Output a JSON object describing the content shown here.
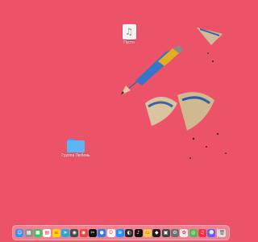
{
  "desktop": {
    "items": [
      {
        "label": "Пусто",
        "icon": "music-file-icon"
      },
      {
        "label": "Группа Любовь",
        "icon": "folder-icon"
      }
    ]
  },
  "dock": {
    "apps": [
      {
        "name": "finder",
        "icon": "finder-icon",
        "color": "#3a8ef0",
        "glyph": "☺"
      },
      {
        "name": "launchpad",
        "icon": "launchpad-icon",
        "color": "#8e8e93",
        "glyph": "▦"
      },
      {
        "name": "facetime",
        "icon": "facetime-icon",
        "color": "#34c759",
        "glyph": "■"
      },
      {
        "name": "calendar",
        "icon": "calendar-icon",
        "color": "#ffffff",
        "glyph": "▤"
      },
      {
        "name": "notes",
        "icon": "notes-icon",
        "color": "#ffd60a",
        "glyph": "≡"
      },
      {
        "name": "telegram",
        "icon": "telegram-icon",
        "color": "#2aa4e0",
        "glyph": "➤"
      },
      {
        "name": "browser",
        "icon": "browser-icon",
        "color": "#4a4a4a",
        "glyph": "◉"
      },
      {
        "name": "chrome",
        "icon": "chrome-icon",
        "color": "#e8453c",
        "glyph": "◉"
      },
      {
        "name": "capcut",
        "icon": "capcut-icon",
        "color": "#111111",
        "glyph": "✂"
      },
      {
        "name": "app-blue",
        "icon": "app-icon",
        "color": "#2c7be5",
        "glyph": "●"
      },
      {
        "name": "opera",
        "icon": "opera-icon",
        "color": "#ffffff",
        "glyph": "O"
      },
      {
        "name": "safari",
        "icon": "safari-icon",
        "color": "#1e90ff",
        "glyph": "⊕"
      },
      {
        "name": "app-dark",
        "icon": "app-icon",
        "color": "#2b2b2b",
        "glyph": "◐"
      },
      {
        "name": "app-black",
        "icon": "app-icon",
        "color": "#111111",
        "glyph": "♪"
      },
      {
        "name": "notes-pad",
        "icon": "notes-icon",
        "color": "#f2c94c",
        "glyph": "▭"
      },
      {
        "name": "figma",
        "icon": "figma-icon",
        "color": "#1e1e1e",
        "glyph": "◆"
      },
      {
        "name": "app-grid",
        "icon": "app-icon",
        "color": "#444444",
        "glyph": "▣"
      },
      {
        "name": "app-settings",
        "icon": "settings-icon",
        "color": "#6e6e73",
        "glyph": "⚙"
      },
      {
        "name": "app-photo",
        "icon": "photos-icon",
        "color": "#eeeeee",
        "glyph": "✿"
      },
      {
        "name": "app-vpn",
        "icon": "app-icon",
        "color": "#5ab552",
        "glyph": "◎"
      },
      {
        "name": "music",
        "icon": "music-icon",
        "color": "#fa2d48",
        "glyph": "♫"
      },
      {
        "name": "discord",
        "icon": "discord-icon",
        "color": "#5865f2",
        "glyph": "☻"
      }
    ],
    "trash": {
      "name": "trash",
      "icon": "trash-icon",
      "color": "#dcdcdc",
      "glyph": "🗑"
    }
  }
}
